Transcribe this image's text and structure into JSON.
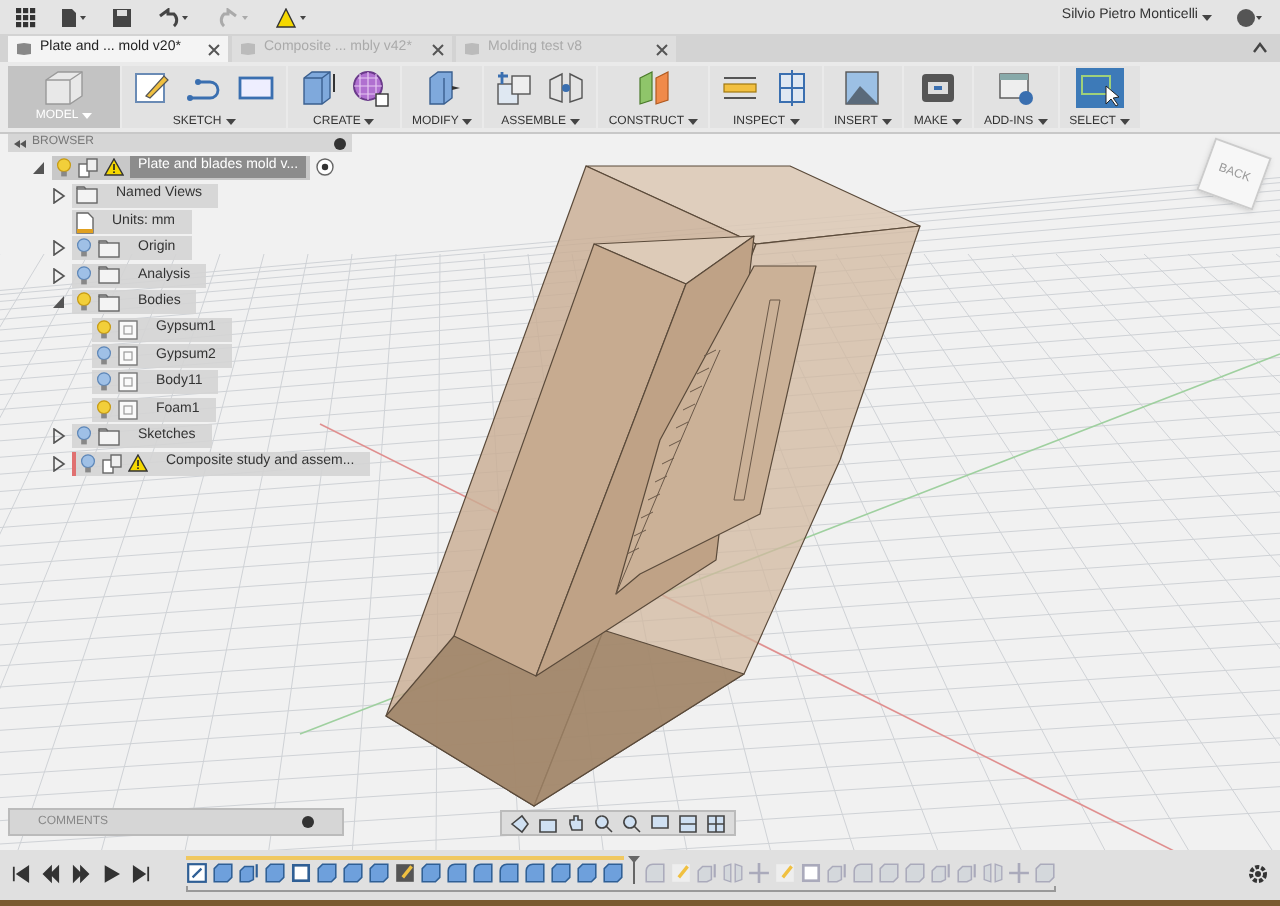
{
  "user": {
    "name": "Silvio Pietro Monticelli"
  },
  "document_tabs": [
    {
      "label": "Plate and ... mold v20*",
      "selected": true
    },
    {
      "label": "Composite ... mbly v42*",
      "selected": false
    },
    {
      "label": "Molding test v8",
      "selected": false
    }
  ],
  "toolbar": {
    "workspace": "MODEL",
    "groups": [
      {
        "label": "SKETCH",
        "tools": [
          {
            "kind": "sketch"
          },
          {
            "kind": "arc"
          },
          {
            "kind": "rectangle"
          }
        ]
      },
      {
        "label": "CREATE",
        "tools": [
          {
            "kind": "extrude"
          },
          {
            "kind": "form"
          }
        ]
      },
      {
        "label": "MODIFY",
        "tools": [
          {
            "kind": "pressPull"
          }
        ]
      },
      {
        "label": "ASSEMBLE",
        "tools": [
          {
            "kind": "component"
          },
          {
            "kind": "joint"
          }
        ]
      },
      {
        "label": "CONSTRUCT",
        "tools": [
          {
            "kind": "plane"
          }
        ]
      },
      {
        "label": "INSPECT",
        "tools": [
          {
            "kind": "measure"
          },
          {
            "kind": "section"
          }
        ]
      },
      {
        "label": "INSERT",
        "tools": [
          {
            "kind": "image"
          }
        ]
      },
      {
        "label": "MAKE",
        "tools": [
          {
            "kind": "print"
          }
        ]
      },
      {
        "label": "ADD-INS",
        "tools": [
          {
            "kind": "scripts"
          }
        ]
      },
      {
        "label": "SELECT",
        "tools": [
          {
            "kind": "select"
          }
        ]
      }
    ]
  },
  "view_cube": {
    "label": "BACK"
  },
  "browser": {
    "title": "BROWSER",
    "root": {
      "label": "Plate and blades mold v...",
      "warning": true,
      "visible": true,
      "expanded": true,
      "children": [
        {
          "label": "Named Views",
          "kind": "folder",
          "expanded": false
        },
        {
          "label": "Units: mm",
          "kind": "units"
        },
        {
          "label": "Origin",
          "kind": "folder",
          "visible": false,
          "expanded": false
        },
        {
          "label": "Analysis",
          "kind": "folder",
          "visible": false,
          "expanded": false
        },
        {
          "label": "Bodies",
          "kind": "folder",
          "visible": true,
          "expanded": true,
          "children": [
            {
              "label": "Gypsum1",
              "kind": "body",
              "visible": true
            },
            {
              "label": "Gypsum2",
              "kind": "body",
              "visible": false
            },
            {
              "label": "Body11",
              "kind": "body",
              "visible": false
            },
            {
              "label": "Foam1",
              "kind": "body",
              "visible": true
            }
          ]
        },
        {
          "label": "Sketches",
          "kind": "folder",
          "visible": false,
          "expanded": false
        },
        {
          "label": "Composite study and assem...",
          "kind": "component",
          "visible": false,
          "expanded": false,
          "warning": true
        }
      ]
    }
  },
  "comments": {
    "title": "COMMENTS"
  },
  "timeline": {
    "features": [
      {
        "kind": "sketch",
        "rolled_back": false
      },
      {
        "kind": "body",
        "rolled_back": false
      },
      {
        "kind": "extrude",
        "rolled_back": false
      },
      {
        "kind": "body",
        "rolled_back": false
      },
      {
        "kind": "box",
        "rolled_back": false
      },
      {
        "kind": "body",
        "rolled_back": false
      },
      {
        "kind": "body",
        "rolled_back": false
      },
      {
        "kind": "body",
        "rolled_back": false
      },
      {
        "kind": "canvas",
        "rolled_back": false
      },
      {
        "kind": "body",
        "rolled_back": false
      },
      {
        "kind": "fillet",
        "rolled_back": false
      },
      {
        "kind": "fillet",
        "rolled_back": false
      },
      {
        "kind": "fillet",
        "rolled_back": false
      },
      {
        "kind": "fillet",
        "rolled_back": false
      },
      {
        "kind": "body",
        "rolled_back": false
      },
      {
        "kind": "body",
        "rolled_back": false
      },
      {
        "kind": "body",
        "rolled_back": false
      },
      {
        "kind": "fillet",
        "rolled_back": true
      },
      {
        "kind": "canvas",
        "rolled_back": true
      },
      {
        "kind": "extrude",
        "rolled_back": true
      },
      {
        "kind": "joint",
        "rolled_back": true
      },
      {
        "kind": "move",
        "rolled_back": true
      },
      {
        "kind": "canvas",
        "rolled_back": true
      },
      {
        "kind": "box",
        "rolled_back": true
      },
      {
        "kind": "extrude",
        "rolled_back": true
      },
      {
        "kind": "fillet",
        "rolled_back": true
      },
      {
        "kind": "body",
        "rolled_back": true
      },
      {
        "kind": "body",
        "rolled_back": true
      },
      {
        "kind": "extrude",
        "rolled_back": true
      },
      {
        "kind": "extrude",
        "rolled_back": true
      },
      {
        "kind": "joint",
        "rolled_back": true
      },
      {
        "kind": "move",
        "rolled_back": true
      },
      {
        "kind": "body",
        "rolled_back": true
      }
    ]
  }
}
